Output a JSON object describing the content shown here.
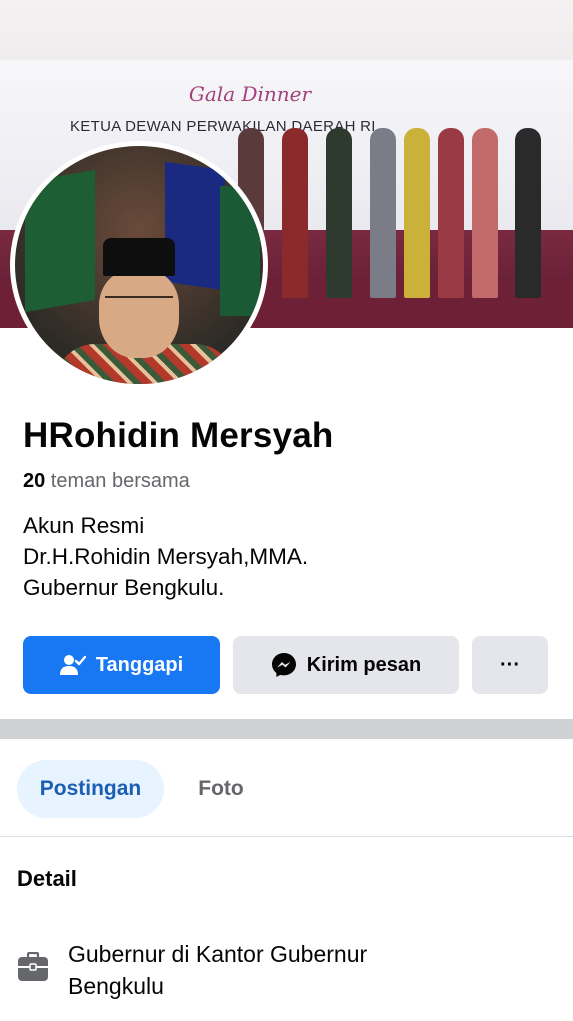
{
  "profile": {
    "name": "HRohidin Mersyah",
    "mutual_count": "20",
    "mutual_label": " teman bersama",
    "bio_lines": [
      "Akun Resmi",
      "Dr.H.Rohidin Mersyah,MMA.",
      "Gubernur Bengkulu."
    ]
  },
  "cover": {
    "script_text": "Gala Dinner",
    "headline_text": "KETUA DEWAN PERWAKILAN DAERAH RI"
  },
  "actions": {
    "primary_label": "Tanggapi",
    "message_label": "Kirim pesan",
    "more_label": "···"
  },
  "tabs": [
    {
      "label": "Postingan",
      "active": true
    },
    {
      "label": "Foto",
      "active": false
    }
  ],
  "details": {
    "title": "Detail",
    "work_lines": [
      "Gubernur di Kantor Gubernur",
      "Bengkulu"
    ]
  },
  "colors": {
    "accent": "#1877f2",
    "secondary_button": "#e4e6eb",
    "active_tab_bg": "#e7f3ff",
    "active_tab_text": "#1a5fb4",
    "muted_text": "#65676b"
  },
  "icons": {
    "primary_button": "person-check-icon",
    "message_button": "messenger-icon",
    "work_detail": "briefcase-icon"
  }
}
